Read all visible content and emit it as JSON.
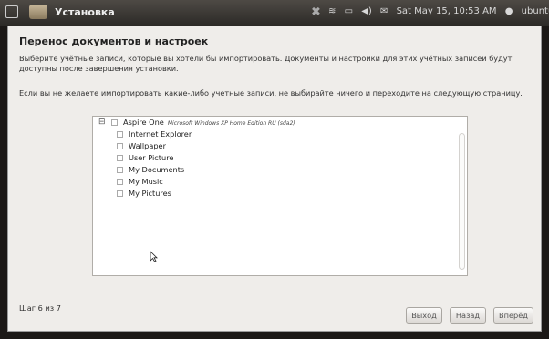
{
  "topbar": {
    "title": "Установка",
    "status_text": "Sat May 15, 10:53 AM",
    "user": "ubuntu"
  },
  "page": {
    "heading": "Перенос документов и настроек",
    "description": "Выберите учётные записи, которые вы хотели бы импортировать. Документы и настройки для этих учётных записей будут доступны после завершения установки.",
    "hint": "Если вы не желаете импортировать какие-либо учетные записи, не выбирайте ничего и переходите на следующую страницу."
  },
  "accounts": {
    "parent_label": "Aspire One",
    "parent_subtitle": "Microsoft Windows XP Home Edition RU (sda2)",
    "items": [
      "Internet Explorer",
      "Wallpaper",
      "User Picture",
      "My Documents",
      "My Music",
      "My Pictures"
    ]
  },
  "footer": {
    "step": "Шаг 6 из 7",
    "quit": "Выход",
    "back": "Назад",
    "forward": "Вперёд"
  },
  "colors": {
    "panel": "#2c2a27",
    "window_bg": "#efedea",
    "list_bg": "#ffffff"
  }
}
